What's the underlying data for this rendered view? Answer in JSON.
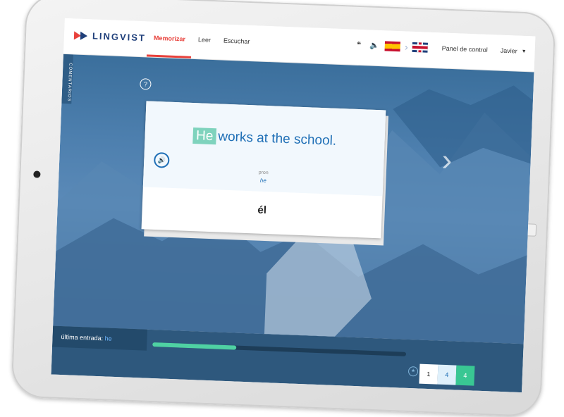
{
  "header": {
    "logo_text": "LINGVIST",
    "nav": [
      {
        "label": "Memorizar",
        "active": true
      },
      {
        "label": "Leer",
        "active": false
      },
      {
        "label": "Escuchar",
        "active": false
      }
    ],
    "icons": [
      "quote-icon",
      "speaker-icon"
    ],
    "source_flag": "spain-flag-icon",
    "target_flag": "uk-flag-icon",
    "panel_link": "Panel de control",
    "user_name": "Javier"
  },
  "sidebar": {
    "label": "COMENTARIOS"
  },
  "card": {
    "highlight_word": "He",
    "sentence_rest": "works at the school.",
    "pron_label": "pron",
    "pron_value": "he",
    "answer": "él"
  },
  "footer": {
    "last_entry_label": "última entrada:",
    "last_entry_word": "he",
    "progress_fraction": 0.33,
    "counters": [
      "1",
      "4",
      "4"
    ]
  },
  "colors": {
    "accent": "#e8413b",
    "brand": "#1f3f7a",
    "highlight": "#7fd3bd",
    "progress": "#4fd1a3",
    "link_blue": "#1f6fb6"
  }
}
